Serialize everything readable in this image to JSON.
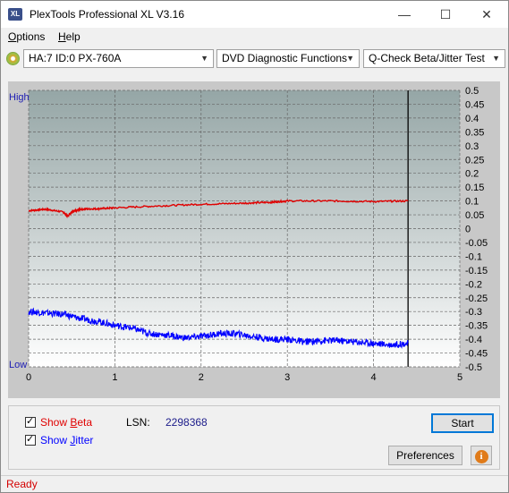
{
  "app": {
    "title": "PlexTools Professional XL V3.16",
    "icon_text": "XL"
  },
  "window_buttons": {
    "minimize": "—",
    "maximize": "☐",
    "close": "✕"
  },
  "menu": {
    "options": {
      "prefix": "",
      "underlined": "O",
      "rest": "ptions"
    },
    "help": {
      "prefix": "",
      "underlined": "H",
      "rest": "elp"
    }
  },
  "toolbar": {
    "drive": "HA:7 ID:0  PX-760A",
    "function": "DVD Diagnostic Functions",
    "test": "Q-Check Beta/Jitter Test"
  },
  "chart_data": {
    "type": "line",
    "x_ticks": [
      "0",
      "1",
      "2",
      "3",
      "4",
      "5"
    ],
    "y_ticks_right": [
      "0.5",
      "0.45",
      "0.4",
      "0.35",
      "0.3",
      "0.25",
      "0.2",
      "0.15",
      "0.1",
      "0.05",
      "0",
      "-0.05",
      "-0.1",
      "-0.15",
      "-0.2",
      "-0.25",
      "-0.3",
      "-0.35",
      "-0.4",
      "-0.45",
      "-0.5"
    ],
    "y_label_high": "High",
    "y_label_low": "Low",
    "xlim": [
      0,
      5
    ],
    "ylim": [
      -0.5,
      0.5
    ],
    "end_marker_x": 4.4,
    "grid": true,
    "series": [
      {
        "color": "#e00000",
        "x": [
          0,
          0.2,
          0.4,
          0.45,
          0.5,
          0.6,
          0.8,
          1.0,
          1.5,
          2.0,
          2.5,
          2.8,
          3.0,
          3.5,
          4.0,
          4.4
        ],
        "y": [
          0.065,
          0.07,
          0.06,
          0.045,
          0.06,
          0.07,
          0.072,
          0.075,
          0.082,
          0.088,
          0.092,
          0.095,
          0.1,
          0.1,
          0.098,
          0.1
        ]
      },
      {
        "color": "#0000ff",
        "x": [
          0,
          0.2,
          0.4,
          0.6,
          0.8,
          1.0,
          1.2,
          1.4,
          1.6,
          1.8,
          2.0,
          2.2,
          2.4,
          2.6,
          2.8,
          3.0,
          3.2,
          3.4,
          3.6,
          3.8,
          4.0,
          4.2,
          4.4
        ],
        "y": [
          -0.3,
          -0.305,
          -0.31,
          -0.325,
          -0.335,
          -0.35,
          -0.36,
          -0.38,
          -0.385,
          -0.395,
          -0.39,
          -0.38,
          -0.38,
          -0.39,
          -0.4,
          -0.4,
          -0.41,
          -0.405,
          -0.405,
          -0.41,
          -0.415,
          -0.42,
          -0.415
        ]
      }
    ]
  },
  "bottom": {
    "show_beta": {
      "prefix": "Show ",
      "underlined": "B",
      "rest": "eta",
      "color": "#e00000"
    },
    "show_jitter": {
      "prefix": "Show ",
      "underlined": "J",
      "rest": "itter",
      "color": "#0000ff"
    },
    "lsn_label": "LSN:",
    "lsn_value": "2298368",
    "start_label": "Start",
    "preferences_label": "Preferences",
    "info_icon": "info-icon"
  },
  "status": {
    "text": "Ready"
  }
}
